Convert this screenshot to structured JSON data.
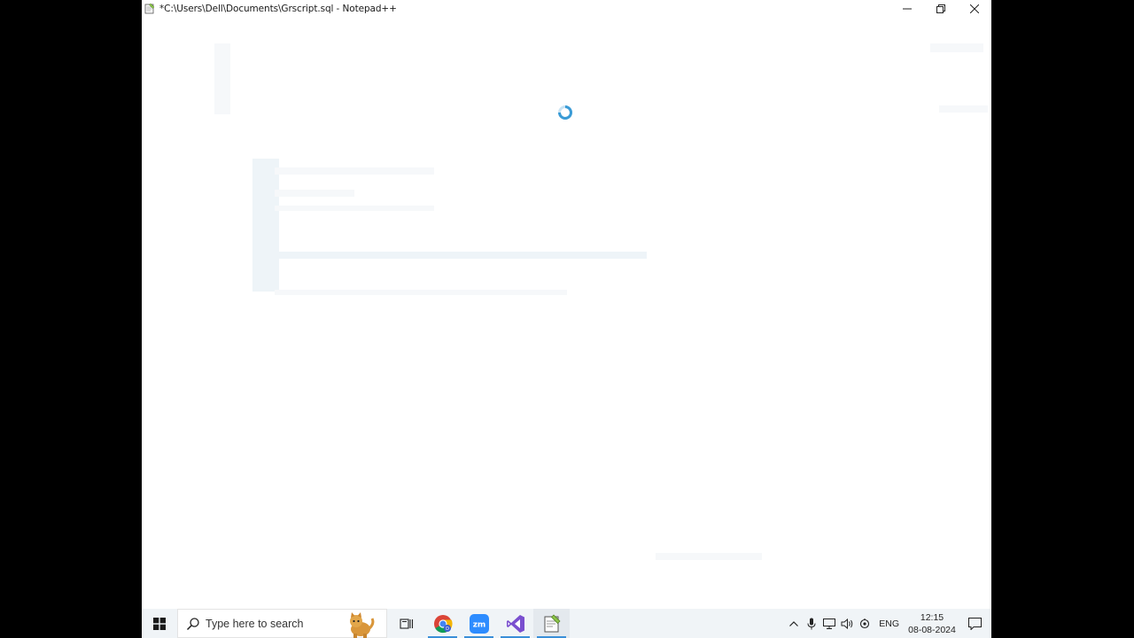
{
  "window": {
    "title": "*C:\\Users\\Dell\\Documents\\Grscript.sql - Notepad++",
    "app_icon": "notepad-plus-plus-icon",
    "controls": [
      "minimize-icon",
      "restore-icon",
      "close-icon"
    ]
  },
  "content": {
    "state": "loading",
    "spinner_icon": "loading-spinner-icon",
    "accent_color": "#3a9bd6"
  },
  "taskbar": {
    "start_icon": "windows-start-icon",
    "search": {
      "placeholder": "Type here to search",
      "icon": "search-icon"
    },
    "apps": [
      {
        "name": "task-view",
        "icon": "task-view-icon"
      },
      {
        "name": "chrome",
        "icon": "chrome-icon"
      },
      {
        "name": "zoom",
        "icon": "zoom-icon",
        "label": "zm"
      },
      {
        "name": "visual-studio",
        "icon": "visual-studio-icon"
      },
      {
        "name": "notepad-plus-plus",
        "icon": "notepad-plus-plus-icon"
      }
    ],
    "tray": {
      "icons": [
        "chevron-up-icon",
        "microphone-icon",
        "network-icon",
        "volume-icon",
        "sync-icon"
      ],
      "language": "ENG",
      "time": "12:15",
      "date": "08-08-2024",
      "notification_icon": "notification-icon"
    }
  }
}
